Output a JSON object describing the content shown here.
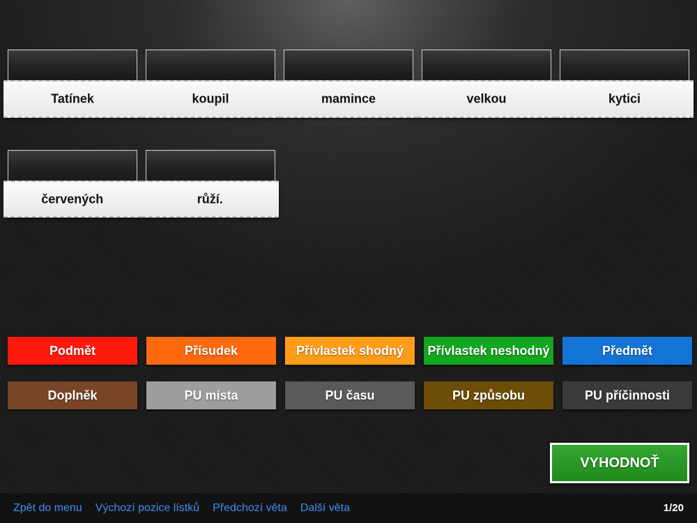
{
  "sentence": {
    "row1": [
      "Tatínek",
      "koupil",
      "mamince",
      "velkou",
      "kytici"
    ],
    "row2": [
      "červených",
      "růží."
    ]
  },
  "categories": {
    "row1": [
      {
        "label": "Podmět",
        "color": "#ff1a0d"
      },
      {
        "label": "Přísudek",
        "color": "#ff6a10"
      },
      {
        "label": "Přívlastek shodný",
        "color": "#ff9d18"
      },
      {
        "label": "Přívlastek neshodný",
        "color": "#12a71f"
      },
      {
        "label": "Předmět",
        "color": "#1474d6"
      }
    ],
    "row2": [
      {
        "label": "Doplněk",
        "color": "#7a4526"
      },
      {
        "label": "PU místa",
        "color": "#9e9e9e"
      },
      {
        "label": "PU času",
        "color": "#5a5a5a"
      },
      {
        "label": "PU způsobu",
        "color": "#6d4d07"
      },
      {
        "label": "PU příčinnosti",
        "color": "#3a3a3a"
      }
    ]
  },
  "evaluate": {
    "label": "VYHODNOŤ",
    "color": "#2a9a27"
  },
  "bottom_bar": {
    "links": [
      "Zpět do menu",
      "Výchozí pozice lístků",
      "Předchozí věta",
      "Další věta"
    ],
    "page_counter": "1/20",
    "link_color": "#3f8ff2"
  }
}
